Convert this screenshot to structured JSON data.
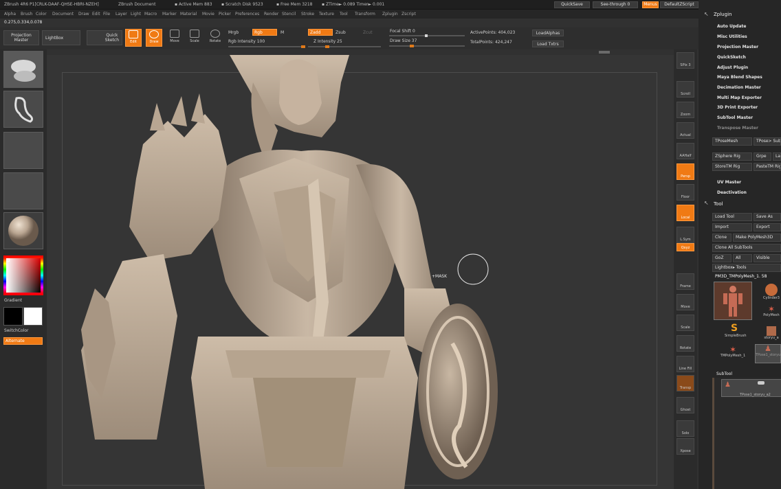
{
  "title_bar": {
    "text": "ZBrush 4R6 P1[CRLK-DAAF-QHSE-HBRI-NZEH]",
    "document": "ZBrush Document",
    "active_mem": "▪ Active Mem 883",
    "scratch_disk": "▪ Scratch Disk 9523",
    "free_mem": "▪ Free Mem 3218",
    "ztime": "▪ ZTime► 0.089 Timer► 0.001",
    "quicksave": "QuickSave",
    "see_through": "See-through  0",
    "menus": "Menus",
    "default_zscript": "DefaultZScript"
  },
  "menu": [
    "Alpha",
    "Brush",
    "Color",
    "Document",
    "Draw",
    "Edit",
    "File",
    "Layer",
    "Light",
    "Macro",
    "Marker",
    "Material",
    "Movie",
    "Picker",
    "Preferences",
    "Render",
    "Stencil",
    "Stroke",
    "Texture",
    "Tool",
    "Transform",
    "Zplugin",
    "Zscript"
  ],
  "coords": "0.275,0.334,0.078",
  "shelf": {
    "projection_master": "Projection\nMaster",
    "lightbox": "LightBox",
    "quick_sketch": "Quick\nSketch",
    "edit": "Edit",
    "draw": "Draw",
    "move": "Move",
    "scale": "Scale",
    "rotate": "Rotate",
    "mrgb": "Mrgb",
    "rgb": "Rgb",
    "m": "M",
    "rgb_intensity": "Rgb Intensity 100",
    "zadd": "Zadd",
    "zsub": "Zsub",
    "zcut": "Zcut",
    "z_intensity": "Z Intensity 25",
    "focal_shift": "Focal Shift 0",
    "draw_size": "Draw Size 37",
    "active_points": "ActivePoints: 404,023",
    "total_points": "TotalPoints: 424,247",
    "load_alphas": "LoadAlphas",
    "load_txtrs": "Load Txtrs",
    "rgb_intensity_value": 100,
    "z_intensity_value": 25,
    "draw_size_value": 37
  },
  "left_panel": {
    "gradient": "Gradient",
    "switch_color": "SwitchColor",
    "alternate": "Alternate"
  },
  "viewport": {
    "cursor_label": "+MASK"
  },
  "right_strip": [
    "SPix 3",
    "Scroll",
    "Zoom",
    "Actual",
    "AAHalf",
    "Persp",
    "Floor",
    "Local",
    "L.Sym",
    "Qxyz",
    "Frame",
    "Move",
    "Scale",
    "Rotate",
    "Line Fill",
    "Transp",
    "Ghost",
    "Solo",
    "Xpose"
  ],
  "zplugin": {
    "header": "Zplugin",
    "items": [
      "Auto Update",
      "Misc Utilities",
      "Projection Master",
      "QuickSketch",
      "Adjust Plugin",
      "Maya Blend Shapes",
      "Decimation Master",
      "Multi Map Exporter",
      "3D Print Exporter",
      "SubTool Master",
      "Transpose Master"
    ],
    "tpose_mesh": "TPoseMesh",
    "tpose_sub": "TPose> SubT",
    "zsphere_rig": "ZSphere Rig",
    "grpe": "Grpe",
    "la": "La",
    "store_tm_rig": "StoreTM Rig",
    "paste_tm_rig": "PasteTM Rig",
    "uv_master": "UV Master",
    "deactivation": "Deactivation"
  },
  "tool": {
    "header": "Tool",
    "load_tool": "Load Tool",
    "save_as": "Save As",
    "import": "Import",
    "export": "Export",
    "clone": "Clone",
    "make_polymesh": "Make PolyMesh3D",
    "clone_all": "Clone All SubTools",
    "goz": "GoZ",
    "all": "All",
    "visible": "Visible",
    "lightbox_tools": "Lightbox▸ Tools",
    "current_tool": "PM3D_TMPolyMesh_1. 58",
    "thumbs": [
      "Cylinder3",
      "PolyMesh",
      "SimpleBrush",
      "storyu_a",
      "TMPolyMesh_1",
      "TPose1_storyu"
    ],
    "subtool_header": "SubTool",
    "subtool_item": "TPose1_storyu_a2"
  },
  "colors": {
    "accent": "#f07a14",
    "panel": "#262626",
    "viewport": "#353535"
  }
}
